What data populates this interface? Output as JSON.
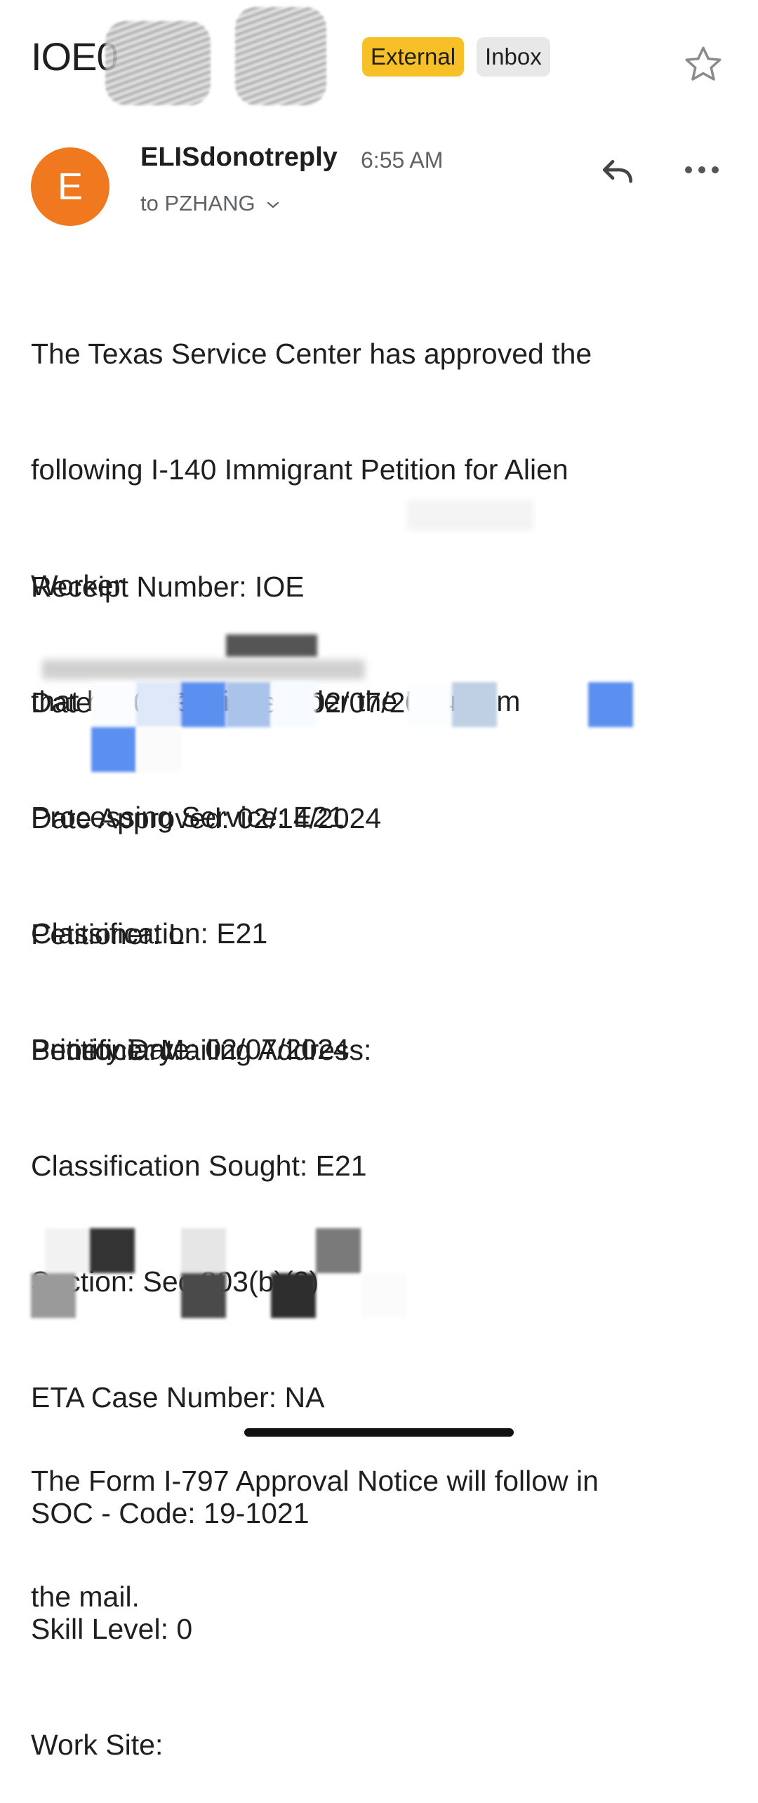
{
  "header": {
    "subject_visible": "IOE0",
    "labels": [
      "External",
      "Inbox"
    ],
    "star_icon": "star-outline-icon"
  },
  "message": {
    "avatar_letter": "E",
    "avatar_color": "#f0781e",
    "sender": "ELISdonotreply",
    "time": "6:55 AM",
    "to": "to PZHANG",
    "reply_icon": "reply-icon",
    "more_icon": "more-horizontal-icon"
  },
  "body": {
    "intro": [
      "The Texas Service Center has approved the",
      "following I-140 Immigrant Petition for Alien",
      "Worker",
      "that had been filed under the Premium",
      "Processing Service: E21"
    ],
    "details": [
      "Receipt Number: IOE",
      "Date I-907 Received: 02/07/2024",
      "Date Approved: 02/14/2024",
      "Petitioner: L",
      "Petitioner Mailing Address:"
    ],
    "classification": [
      "Classification: E21",
      "Priority Date: 02/07/2024"
    ],
    "beneficiary": [
      "Beneficiary:",
      "Classification Sought: E21",
      "Section: Sec.203(b)(2)",
      "ETA Case Number: NA",
      "SOC - Code: 19-1021",
      "Skill Level: 0",
      "Work Site:"
    ],
    "closing": [
      "The Form I-797 Approval Notice will follow in",
      "the mail."
    ]
  }
}
